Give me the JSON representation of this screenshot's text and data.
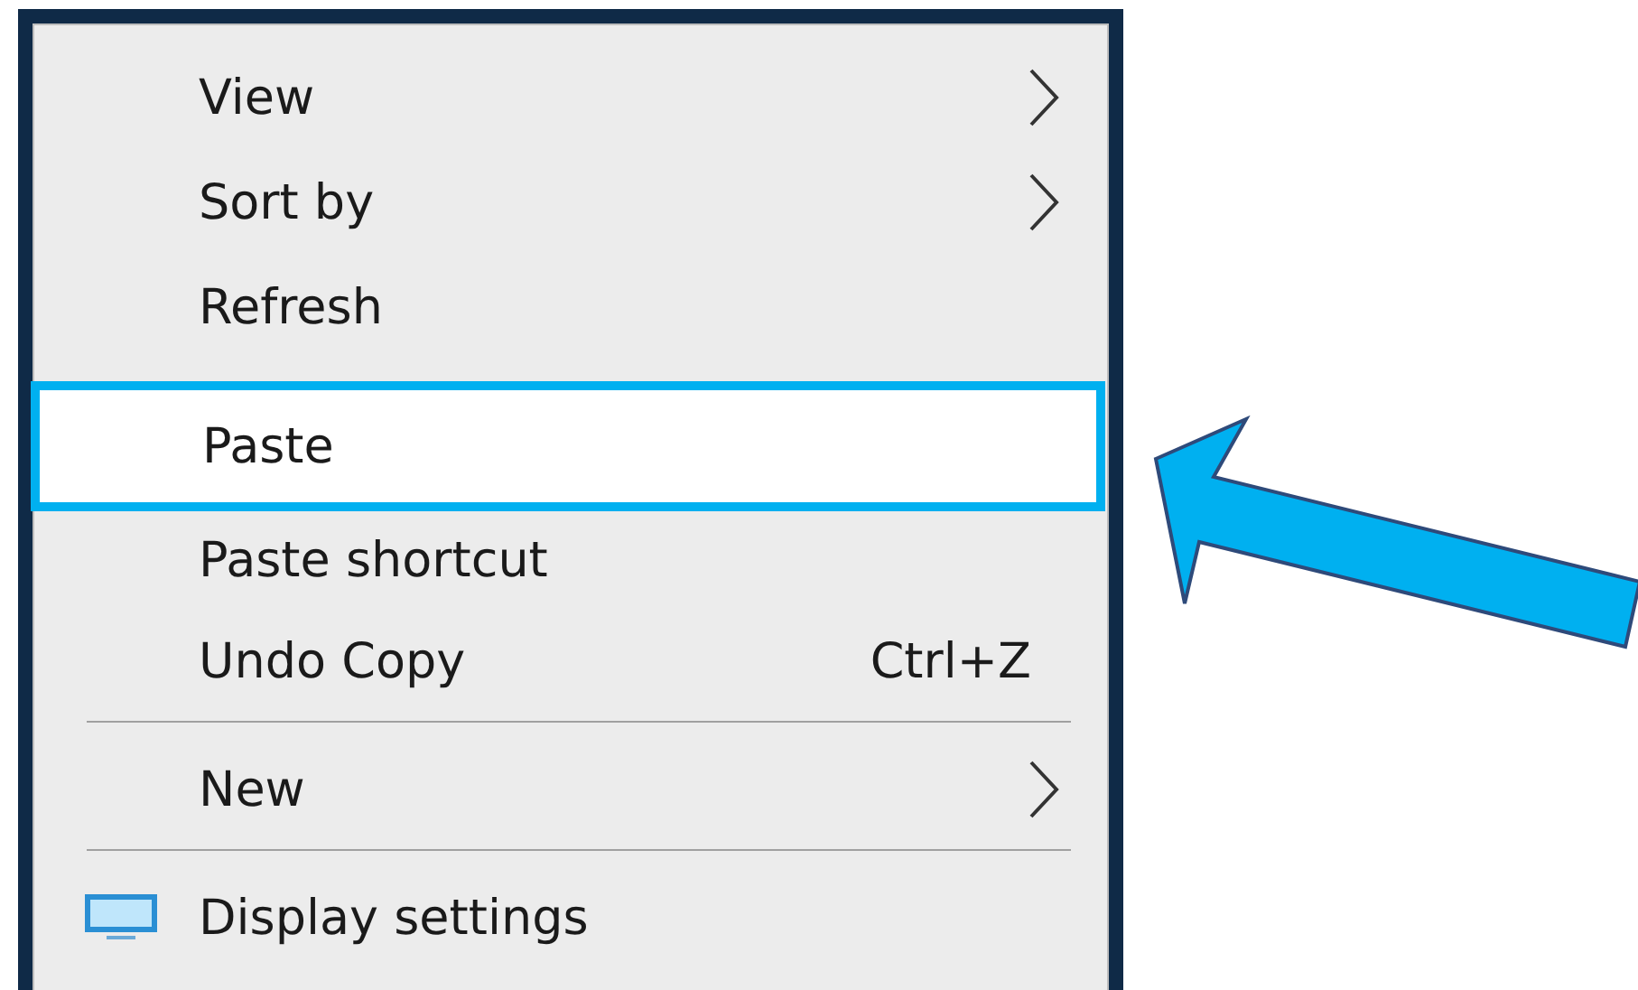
{
  "menu": {
    "items": [
      {
        "kind": "item",
        "label": "View",
        "submenu": true,
        "selected": false
      },
      {
        "kind": "item",
        "label": "Sort by",
        "submenu": true,
        "selected": false
      },
      {
        "kind": "item",
        "label": "Refresh",
        "submenu": false,
        "selected": false
      },
      {
        "kind": "item",
        "label": "Paste",
        "submenu": false,
        "selected": true
      },
      {
        "kind": "item",
        "label": "Paste shortcut",
        "submenu": false,
        "selected": false
      },
      {
        "kind": "item",
        "label": "Undo Copy",
        "shortcut": "Ctrl+Z",
        "submenu": false,
        "selected": false
      },
      {
        "kind": "separator"
      },
      {
        "kind": "item",
        "label": "New",
        "submenu": true,
        "selected": false
      },
      {
        "kind": "separator"
      },
      {
        "kind": "display-item",
        "label": "Display settings",
        "submenu": false,
        "selected": false
      }
    ]
  }
}
